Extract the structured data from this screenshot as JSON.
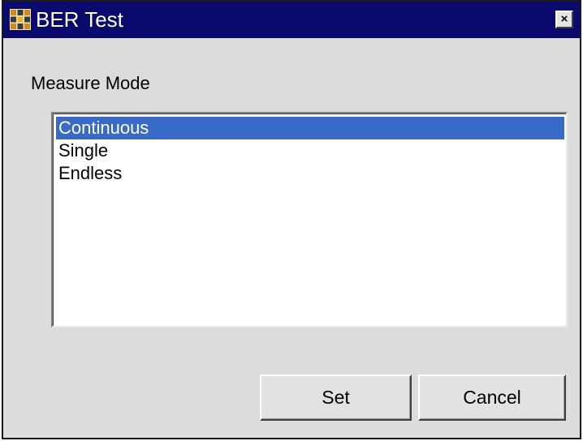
{
  "window": {
    "title": "BER Test",
    "icon": "app-grid-icon",
    "close_glyph": "×",
    "title_bar_color": "#0a0a6e"
  },
  "measure_mode": {
    "label": "Measure Mode",
    "options": [
      "Continuous",
      "Single",
      "Endless"
    ],
    "selected": "Continuous",
    "selection_color": "#3a6ac8"
  },
  "buttons": {
    "set_label": "Set",
    "cancel_label": "Cancel"
  }
}
